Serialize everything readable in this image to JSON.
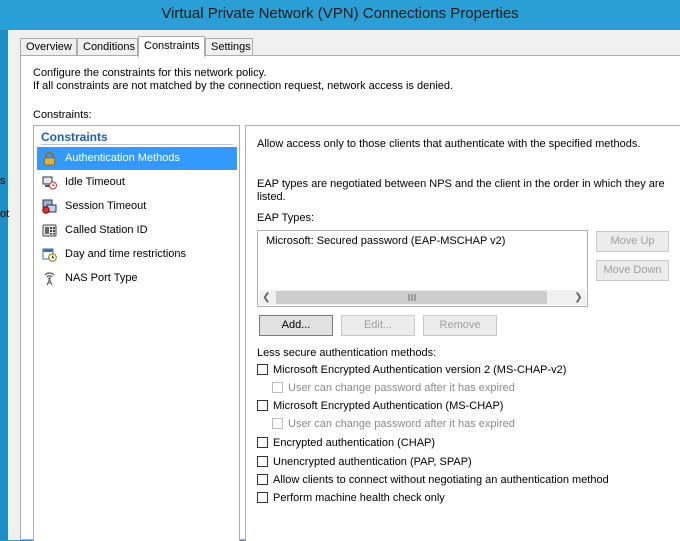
{
  "window": {
    "title": "Virtual Private Network (VPN) Connections Properties"
  },
  "tabs": [
    {
      "label": "Overview"
    },
    {
      "label": "Conditions"
    },
    {
      "label": "Constraints"
    },
    {
      "label": "Settings"
    }
  ],
  "left_edge_fragments": [
    "s",
    "ot"
  ],
  "description": {
    "line1": "Configure the constraints for this network policy.",
    "line2": "If all constraints are not matched by the connection request, network access is denied."
  },
  "constraints_label": "Constraints:",
  "constraints_list": {
    "header": "Constraints",
    "items": [
      {
        "label": "Authentication Methods",
        "icon": "padlock-icon"
      },
      {
        "label": "Idle Timeout",
        "icon": "idle-timeout-icon"
      },
      {
        "label": "Session Timeout",
        "icon": "session-timeout-icon"
      },
      {
        "label": "Called Station ID",
        "icon": "phone-icon"
      },
      {
        "label": "Day and time restrictions",
        "icon": "calendar-clock-icon"
      },
      {
        "label": "NAS Port Type",
        "icon": "antenna-icon"
      }
    ]
  },
  "auth": {
    "intro": "Allow access only to those clients that authenticate with the specified methods.",
    "eap_note_line1": "EAP types are negotiated between NPS and the client in the order in which they are",
    "eap_note_line2": "listed.",
    "eap_types_label": "EAP Types:",
    "eap_types": [
      "Microsoft: Secured password (EAP-MSCHAP v2)"
    ],
    "move_up": "Move Up",
    "move_down": "Move Down",
    "add": "Add...",
    "edit": "Edit...",
    "remove": "Remove",
    "less_secure_label": "Less secure authentication methods:",
    "methods": [
      {
        "label": "Microsoft Encrypted Authentication version 2 (MS-CHAP-v2)",
        "checked": false
      },
      {
        "label": "User can change password after it has expired",
        "checked": false,
        "sub": true,
        "disabled": true
      },
      {
        "label": "Microsoft Encrypted Authentication (MS-CHAP)",
        "checked": false
      },
      {
        "label": "User can change password after it has expired",
        "checked": false,
        "sub": true,
        "disabled": true
      },
      {
        "label": "Encrypted authentication (CHAP)",
        "checked": false
      },
      {
        "label": "Unencrypted authentication (PAP, SPAP)",
        "checked": false
      },
      {
        "label": "Allow clients to connect without negotiating an authentication method",
        "checked": false
      },
      {
        "label": "Perform machine health check only",
        "checked": false
      }
    ]
  },
  "colors": {
    "title_bar": "#2a9fd6",
    "selection": "#3399ff",
    "header_text": "#1f5fb0"
  }
}
